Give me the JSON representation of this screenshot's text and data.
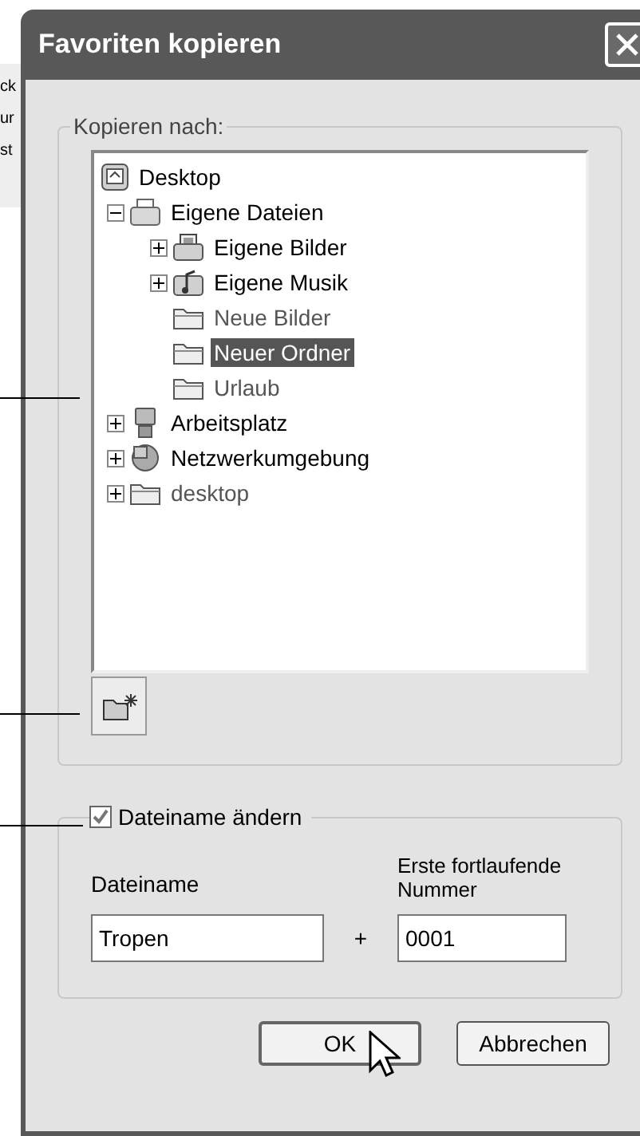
{
  "background_window": {
    "texts": [
      "ck",
      "ur",
      "st"
    ]
  },
  "window": {
    "title": "Favoriten kopieren"
  },
  "destination_group": {
    "label": "Kopieren nach:",
    "tree": [
      {
        "label": "Desktop",
        "kind": "desktop",
        "selected": false,
        "children": [
          {
            "label": "Eigene Dateien",
            "kind": "documents",
            "selected": false,
            "expanded": true,
            "children": [
              {
                "label": "Eigene Bilder",
                "kind": "pictures",
                "selected": false,
                "expanded": false
              },
              {
                "label": "Eigene Musik",
                "kind": "music",
                "selected": false,
                "expanded": false
              },
              {
                "label": "Neue Bilder",
                "kind": "folder",
                "selected": false
              },
              {
                "label": "Neuer Ordner",
                "kind": "folder",
                "selected": true
              },
              {
                "label": "Urlaub",
                "kind": "folder",
                "selected": false
              }
            ]
          },
          {
            "label": "Arbeitsplatz",
            "kind": "computer",
            "selected": false,
            "expanded": false
          },
          {
            "label": "Netzwerkumgebung",
            "kind": "network",
            "selected": false,
            "expanded": false
          },
          {
            "label": "desktop",
            "kind": "folder",
            "selected": false,
            "expanded": false
          }
        ]
      }
    ]
  },
  "rename_group": {
    "label": "Dateiname ändern",
    "checked": true,
    "filename_label": "Dateiname",
    "filename_value": "Tropen",
    "plus": "+",
    "number_label": "Erste fortlaufende Nummer",
    "number_value": "0001"
  },
  "buttons": [
    {
      "label": "OK",
      "focused": true
    },
    {
      "label": "Abbrechen",
      "focused": false
    }
  ]
}
